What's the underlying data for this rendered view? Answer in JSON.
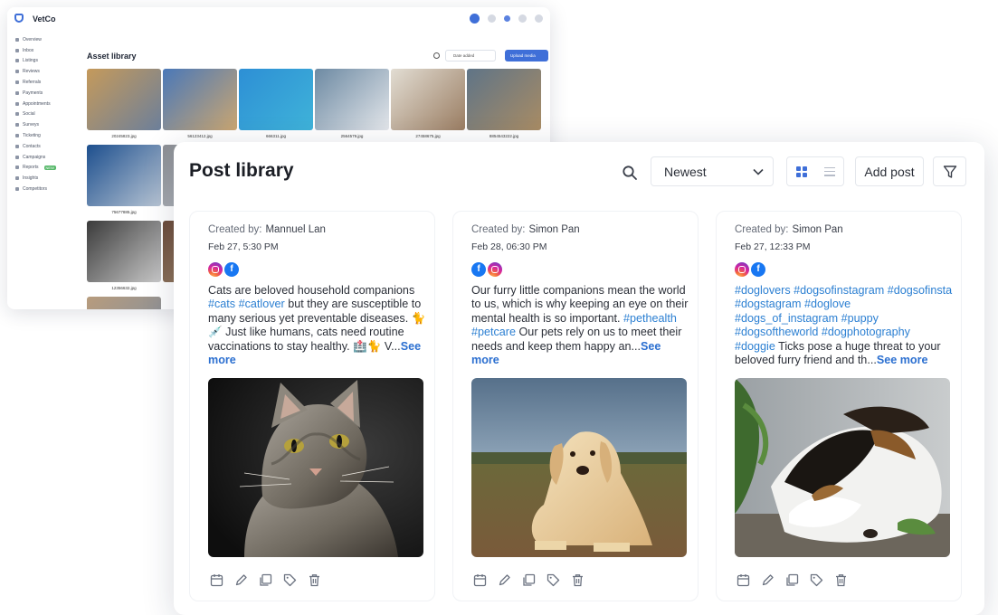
{
  "asset_window": {
    "brand": "VetCo",
    "title": "Asset library",
    "sort_label": "Date added",
    "upload_label": "Upload media",
    "sidebar_items": [
      {
        "label": "Overview"
      },
      {
        "label": "Inbox"
      },
      {
        "label": "Listings"
      },
      {
        "label": "Reviews"
      },
      {
        "label": "Referrals"
      },
      {
        "label": "Payments"
      },
      {
        "label": "Appointments"
      },
      {
        "label": "Social"
      },
      {
        "label": "Surveys"
      },
      {
        "label": "Ticketing"
      },
      {
        "label": "Contacts"
      },
      {
        "label": "Campaigns"
      },
      {
        "label": "Reports",
        "badge": "NEW"
      },
      {
        "label": "Insights"
      },
      {
        "label": "Competitors"
      }
    ],
    "assets": [
      {
        "name": "20245823.jpg"
      },
      {
        "name": "56123412.jpg"
      },
      {
        "name": "666311.jpg"
      },
      {
        "name": "2564579.jpg"
      },
      {
        "name": "27458675.jpg"
      },
      {
        "name": "8854543222.jpg"
      },
      {
        "name": "75677885.jpg"
      },
      {
        "name": "12356632.jpg"
      }
    ]
  },
  "post_window": {
    "title": "Post library",
    "sort_value": "Newest",
    "add_label": "Add post",
    "created_by_label": "Created by:",
    "see_more_label": "See more",
    "posts": [
      {
        "author": "Mannuel Lan",
        "date": "Feb 27, 5:30 PM",
        "channels": [
          "instagram-icon",
          "facebook-icon"
        ],
        "text": {
          "p1": "Cats are beloved household companions ",
          "t1": "#cats",
          "t2": "#catlover",
          "p2": " but they are susceptible to many serious yet preventable diseases. 🐈💉 Just like humans, cats need routine vaccinations to stay healthy. 🏥🐈 V..."
        },
        "image": "cat-photo"
      },
      {
        "author": "Simon Pan",
        "date": "Feb 28, 06:30 PM",
        "channels": [
          "facebook-icon",
          "instagram-icon"
        ],
        "text": {
          "p1": "Our furry little companions mean the world to us, which is why keeping an eye on their mental health is so important. ",
          "t1": "#pethealth",
          "t2": "#petcare",
          "p2": " Our pets rely on us to meet their needs and keep them happy an..."
        },
        "image": "golden-retriever-photo"
      },
      {
        "author": "Simon Pan",
        "date": "Feb 27, 12:33 PM",
        "channels": [
          "instagram-icon",
          "facebook-icon"
        ],
        "text": {
          "tags": "#doglovers #dogsofinstagram #dogsofinsta #dogstagram #doglove #dogs_of_instagram #puppy #dogsoftheworld #dogphotography #doggie",
          "p2": " Ticks pose a huge threat to your beloved furry friend and th..."
        },
        "image": "sleeping-puppy-photo"
      }
    ]
  },
  "colors": {
    "accent": "#3f6fd8",
    "hashtag": "#2b7fd2",
    "facebook": "#1877f2"
  }
}
